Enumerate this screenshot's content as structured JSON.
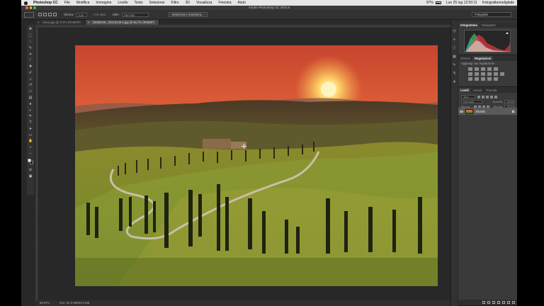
{
  "menubar": {
    "items": [
      "Photoshop CC",
      "File",
      "Modifica",
      "Immagine",
      "Livello",
      "Testo",
      "Selezione",
      "Filtro",
      "3D",
      "Visualizza",
      "Finestra",
      "Aiuto"
    ],
    "battery": "97%",
    "datetime": "Lun 25 lug  12:50:11",
    "user": "Fotografiamodigitale"
  },
  "window": {
    "title": "Adobe Photoshop CC 2015.5"
  },
  "options": {
    "feather_label": "Sfuma:",
    "feather_value": "0 px",
    "antialias_label": "Anti-alias",
    "style_label": "Stile:",
    "style_value": "Normale",
    "select_mask_button": "Seleziona e maschera...",
    "workspace": "Fotografia"
  },
  "tabs": [
    {
      "label": "Sonia.jpg @ 272% (RGB/8#)",
      "active": false
    },
    {
      "label": "20052016-_DSC6146-2.jpg @ 66,7% (RGB/8*)",
      "active": true
    }
  ],
  "status": {
    "zoom": "66,67%",
    "doc": "Doc: 54,9 MB/54,9 MB"
  },
  "panels": {
    "histogram_tabs": [
      "Istogramma",
      "Navigatore"
    ],
    "adjustments_tabs": [
      "Librerie",
      "Regolazioni"
    ],
    "adjustments_title": "Aggiungi una regolazione",
    "layers_tabs": [
      "Livelli",
      "Canali",
      "Tracciati"
    ],
    "layers_filter": "Tipo",
    "blend_mode": "Normale",
    "opacity_label": "Opacità:",
    "opacity_value": "100%",
    "lock_label": "Blocca:",
    "fill_label": "Riempi:",
    "fill_value": "100%",
    "layer_name": "Sfondo"
  },
  "colors": {
    "accent": "#e88a3a",
    "ui_dark": "#282828",
    "panel": "#3a3a3a"
  }
}
